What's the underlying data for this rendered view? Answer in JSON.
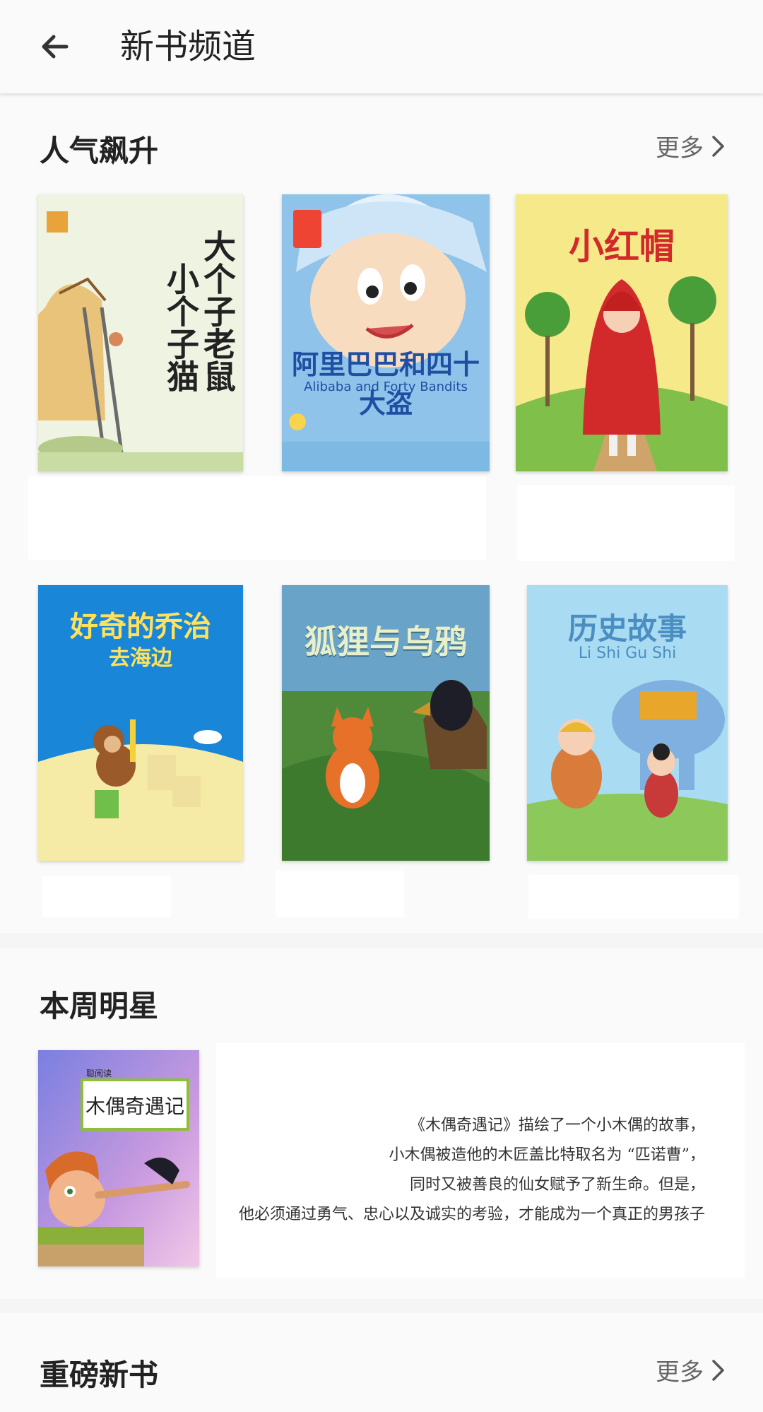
{
  "header": {
    "title": "新书频道"
  },
  "hot": {
    "title": "人气飙升",
    "more_label": "更多",
    "books": [
      {
        "cover_title": "大个子老鼠小个子猫",
        "bg": "#eef3e2",
        "accent": "#c46b2a"
      },
      {
        "cover_title": "阿里巴巴和四十大盗",
        "subtitle": "Alibaba and Forty Bandits",
        "bg": "#8fc3ea",
        "accent": "#2f6fb5"
      },
      {
        "cover_title": "小红帽",
        "bg": "#f6e98a",
        "accent": "#d22a2a"
      },
      {
        "cover_title": "好奇的乔治",
        "subtitle": "去海边",
        "bg": "#1a86d8",
        "accent": "#ffe15a"
      },
      {
        "cover_title": "狐狸与乌鸦",
        "bg": "#6aa3c8",
        "accent": "#e7f0c8"
      },
      {
        "cover_title": "历史故事",
        "subtitle": "Li Shi Gu Shi",
        "bg": "#a9dbf2",
        "accent": "#4a8ec2"
      }
    ]
  },
  "star": {
    "title": "本周明星",
    "book": {
      "cover_title": "木偶奇遇记",
      "label": "聪阅读"
    },
    "description_lines": [
      "《木偶奇遇记》描绘了一个小木偶的故事，",
      "小木偶被造他的木匠盖比特取名为 “匹诺曹”，",
      "同时又被善良的仙女赋予了新生命。但是，",
      "他必须通过勇气、忠心以及诚实的考验，才能成为一个真正的男孩子"
    ]
  },
  "new": {
    "title": "重磅新书",
    "more_label": "更多"
  }
}
